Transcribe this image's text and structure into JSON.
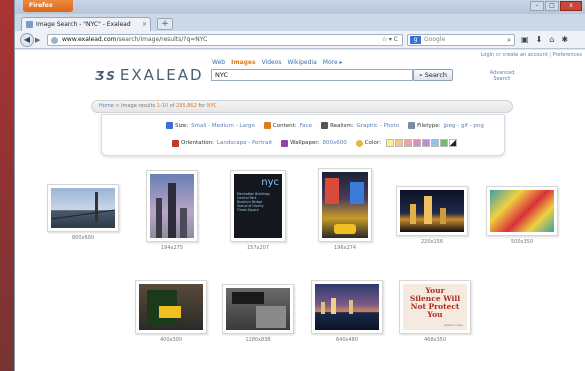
{
  "browser": {
    "app_button": "Firefox",
    "tab_title": "Image Search - \"NYC\" - Exalead",
    "new_tab": "+",
    "tab_close": "×",
    "url_domain": "www.exalead.com",
    "url_path": "/search/image/results/?q=NYC",
    "url_right": "☆ ▾ C",
    "search_engine": "Google",
    "search_engine_initial": "g"
  },
  "window_controls": {
    "minimize": "–",
    "maximize": "□",
    "close": "x"
  },
  "page": {
    "top_links": {
      "login": "Login",
      "or": "or",
      "create": "create an account",
      "preferences": "Preferences"
    },
    "logo": {
      "mark": "ƷS",
      "text": "EXALEAD"
    },
    "search_tabs": [
      "Web",
      "Images",
      "Videos",
      "Wikipedia",
      "More ▸"
    ],
    "active_tab": "Images",
    "query": "NYC",
    "search_button": "Search",
    "advanced_search": "Advanced Search",
    "breadcrumb": {
      "home": "Home",
      "sep": " > ",
      "section": "Image results",
      "range": "1-10",
      "of": "of",
      "total": "295,862",
      "for": "for",
      "query": "NYC"
    },
    "filters": {
      "size": {
        "label": "Size:",
        "values": [
          "Small",
          "Medium",
          "Large"
        ]
      },
      "content": {
        "label": "Content:",
        "values": [
          "Face"
        ]
      },
      "realism": {
        "label": "Realism:",
        "values": [
          "Graphic",
          "Photo"
        ]
      },
      "filetype": {
        "label": "Filetype:",
        "values": [
          "jpeg",
          "gif",
          "png"
        ]
      },
      "orientation": {
        "label": "Orientation:",
        "values": [
          "Landscape",
          "Portrait"
        ]
      },
      "wallpaper": {
        "label": "Wallpaper:",
        "values": [
          "800x600"
        ]
      },
      "color": {
        "label": "Color:",
        "swatches": [
          "#f7f28a",
          "#f5c58a",
          "#f2a0a0",
          "#e08ac0",
          "#c38ae0",
          "#8ac8e0",
          "#7ab86a",
          "#333333"
        ]
      }
    },
    "results": [
      {
        "caption": "800x600",
        "thumb": "bridge"
      },
      {
        "caption": "194x275",
        "thumb": "skyline-tall"
      },
      {
        "caption": "157x207",
        "thumb": "nyc-poster"
      },
      {
        "caption": "196x274",
        "thumb": "times-square"
      },
      {
        "caption": "220x156",
        "thumb": "night-skyline"
      },
      {
        "caption": "500x350",
        "thumb": "colorful-map"
      },
      {
        "caption": "400x300",
        "thumb": "street-sign"
      },
      {
        "caption": "1280x838",
        "thumb": "subway-entrance"
      },
      {
        "caption": "640x480",
        "thumb": "harbor-night"
      },
      {
        "caption": "468x350",
        "thumb": "silence-quote"
      }
    ],
    "poster_text": [
      "nyc",
      "Manhattan Buildings",
      "Central Park",
      "Brooklyn Bridge",
      "Statue of Liberty",
      "Times Square"
    ],
    "quote_text": [
      "Your",
      "Silence Will",
      "Not Protect",
      "You"
    ],
    "quote_author": "Audre Lorde"
  }
}
